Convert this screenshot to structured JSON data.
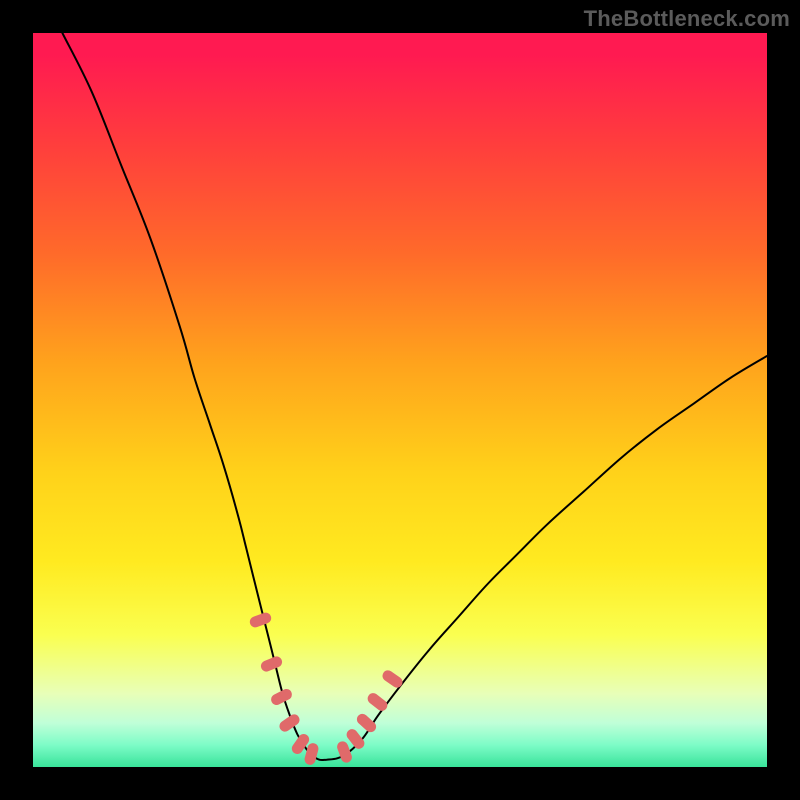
{
  "watermark": "TheBottleneck.com",
  "colors": {
    "background": "#000000",
    "curve_stroke": "#000000",
    "tick_fill": "#e06a6a",
    "gradient_top": "#ff1a51",
    "gradient_bottom": "#39e39a"
  },
  "chart_data": {
    "type": "line",
    "title": "",
    "xlabel": "",
    "ylabel": "",
    "xlim": [
      0,
      100
    ],
    "ylim": [
      0,
      100
    ],
    "grid": false,
    "legend": null,
    "series": [
      {
        "name": "bottleneck-curve",
        "x": [
          4,
          8,
          12,
          16,
          20,
          22,
          24,
          26,
          28,
          29,
          30,
          31,
          32,
          33,
          34,
          35,
          36,
          37,
          38,
          39,
          40,
          41.5,
          43,
          45,
          47,
          50,
          54,
          58,
          62,
          66,
          70,
          75,
          80,
          85,
          90,
          95,
          100
        ],
        "y": [
          100,
          92,
          82,
          72,
          60,
          53,
          47,
          41,
          34,
          30,
          26,
          22,
          18,
          14,
          10,
          7,
          4.5,
          2.8,
          1.6,
          1,
          1,
          1.2,
          2,
          4,
          7,
          11,
          16,
          20.5,
          25,
          29,
          33,
          37.5,
          42,
          46,
          49.5,
          53,
          56
        ]
      }
    ],
    "annotations": {
      "ticks_left": [
        {
          "x": 31.0,
          "y": 20.0,
          "angle_deg": 70
        },
        {
          "x": 32.5,
          "y": 14.0,
          "angle_deg": 68
        },
        {
          "x": 33.8,
          "y": 9.5,
          "angle_deg": 63
        },
        {
          "x": 35.0,
          "y": 6.0,
          "angle_deg": 55
        },
        {
          "x": 36.5,
          "y": 3.2,
          "angle_deg": 35
        },
        {
          "x": 38.0,
          "y": 1.8,
          "angle_deg": 15
        }
      ],
      "ticks_right": [
        {
          "x": 42.5,
          "y": 2.0,
          "angle_deg": -20
        },
        {
          "x": 44.0,
          "y": 3.8,
          "angle_deg": -38
        },
        {
          "x": 45.5,
          "y": 6.0,
          "angle_deg": -48
        },
        {
          "x": 47.0,
          "y": 8.8,
          "angle_deg": -52
        },
        {
          "x": 49.0,
          "y": 12.0,
          "angle_deg": -55
        }
      ]
    }
  }
}
